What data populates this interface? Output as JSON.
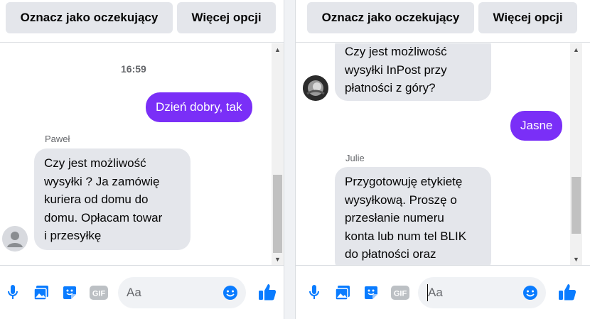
{
  "colors": {
    "accent": "#7a2ff7",
    "bubble_in": "#e4e6eb",
    "icon_blue": "#0a7cff",
    "muted": "#65676b"
  },
  "left": {
    "header": {
      "mark_pending": "Oznacz jako oczekujący",
      "more_options": "Więcej opcji"
    },
    "timestamp": "16:59",
    "outgoing": "Dzień dobry, tak",
    "sender": "Paweł",
    "incoming": "Czy jest możliwość\nwysyłki ? Ja zamówię\nkuriera od domu do\ndomu. Opłacam towar\ni przesyłkę",
    "input_placeholder": "Aa",
    "icons": [
      "microphone-icon",
      "photo-icon",
      "sticker-icon",
      "gif-icon",
      "emoji-icon",
      "like-icon"
    ]
  },
  "right": {
    "header": {
      "mark_pending": "Oznacz jako oczekujący",
      "more_options": "Więcej opcji"
    },
    "incoming_top": "Czy jest możliwość\nwysyłki InPost przy\npłatności z góry?",
    "outgoing": "Jasne",
    "sender": "Julie",
    "incoming_bottom": "Przygotowuję etykietę\nwysyłkową. Proszę o\nprzesłanie numeru\nkonta lub num tel BLIK\ndo płatności oraz",
    "input_placeholder": "Aa",
    "icons": [
      "microphone-icon",
      "photo-icon",
      "sticker-icon",
      "gif-icon",
      "emoji-icon",
      "like-icon"
    ]
  }
}
